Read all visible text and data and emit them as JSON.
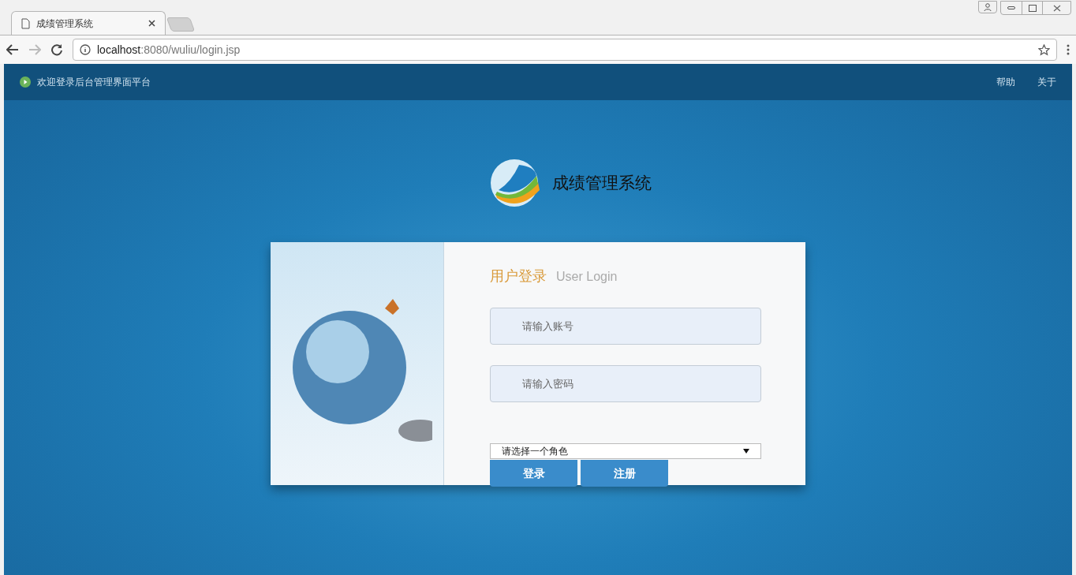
{
  "browser": {
    "tabs": [
      {
        "title": "成绩管理系统",
        "selected": true
      }
    ],
    "url_host": "localhost",
    "url_path": ":8080/wuliu/login.jsp"
  },
  "topbar": {
    "welcome": "欢迎登录后台管理界面平台",
    "links": [
      "帮助",
      "关于"
    ]
  },
  "brand": {
    "title": "成绩管理系统"
  },
  "login": {
    "heading": "用户登录",
    "heading_en": "User Login",
    "fields": [
      {
        "placeholder": "请输入账号"
      },
      {
        "placeholder": "请输入密码"
      }
    ],
    "role_select": {
      "value": "请选择一个角色"
    },
    "buttons": [
      "登录",
      "注册"
    ]
  }
}
